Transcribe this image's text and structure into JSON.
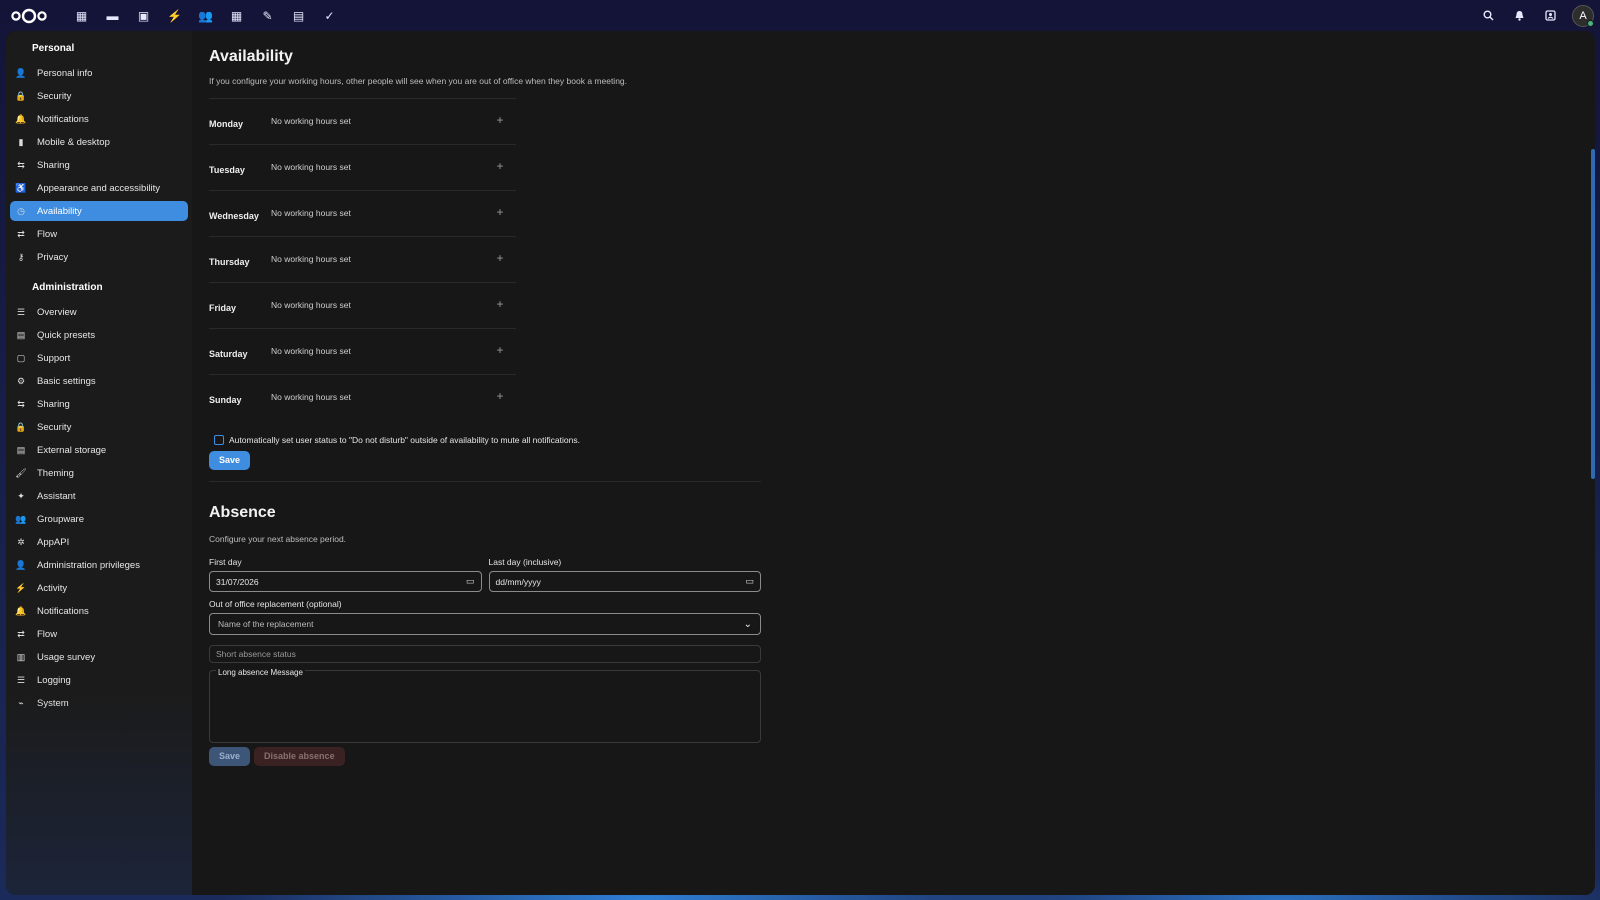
{
  "header": {
    "apps": [
      {
        "icon": "dashboard-icon",
        "glyph": "▦"
      },
      {
        "icon": "files-icon",
        "glyph": "▬"
      },
      {
        "icon": "photos-icon",
        "glyph": "▣"
      },
      {
        "icon": "activity-icon",
        "glyph": "⚡"
      },
      {
        "icon": "contacts-icon",
        "glyph": "👥"
      },
      {
        "icon": "calendar-icon",
        "glyph": "▦"
      },
      {
        "icon": "notes-icon",
        "glyph": "✎"
      },
      {
        "icon": "deck-icon",
        "glyph": "▤"
      },
      {
        "icon": "tasks-icon",
        "glyph": "✓"
      }
    ],
    "avatar_letter": "A"
  },
  "sidebar": {
    "personal_caption": "Personal",
    "personal_items": [
      {
        "label": "Personal info",
        "icon": "person-icon",
        "glyph": "👤"
      },
      {
        "label": "Security",
        "icon": "lock-icon",
        "glyph": "🔒"
      },
      {
        "label": "Notifications",
        "icon": "bell-icon",
        "glyph": "🔔"
      },
      {
        "label": "Mobile & desktop",
        "icon": "phone-icon",
        "glyph": "▮"
      },
      {
        "label": "Sharing",
        "icon": "share-icon",
        "glyph": "⇆"
      },
      {
        "label": "Appearance and accessibility",
        "icon": "accessibility-icon",
        "glyph": "♿"
      },
      {
        "label": "Availability",
        "icon": "clock-icon",
        "glyph": "◷"
      },
      {
        "label": "Flow",
        "icon": "flow-icon",
        "glyph": "⇄"
      },
      {
        "label": "Privacy",
        "icon": "key-icon",
        "glyph": "⚷"
      }
    ],
    "admin_caption": "Administration",
    "admin_items": [
      {
        "label": "Overview",
        "icon": "overview-icon",
        "glyph": "☰"
      },
      {
        "label": "Quick presets",
        "icon": "presets-icon",
        "glyph": "▤"
      },
      {
        "label": "Support",
        "icon": "support-icon",
        "glyph": "▢"
      },
      {
        "label": "Basic settings",
        "icon": "settings-icon",
        "glyph": "⚙"
      },
      {
        "label": "Sharing",
        "icon": "share-icon",
        "glyph": "⇆"
      },
      {
        "label": "Security",
        "icon": "lock-icon",
        "glyph": "🔒"
      },
      {
        "label": "External storage",
        "icon": "storage-icon",
        "glyph": "▤"
      },
      {
        "label": "Theming",
        "icon": "theming-icon",
        "glyph": "🖌"
      },
      {
        "label": "Assistant",
        "icon": "assistant-icon",
        "glyph": "✦"
      },
      {
        "label": "Groupware",
        "icon": "groupware-icon",
        "glyph": "👥"
      },
      {
        "label": "AppAPI",
        "icon": "appapi-icon",
        "glyph": "✲"
      },
      {
        "label": "Administration privileges",
        "icon": "privileges-icon",
        "glyph": "👤"
      },
      {
        "label": "Activity",
        "icon": "activity-icon",
        "glyph": "⚡"
      },
      {
        "label": "Notifications",
        "icon": "bell-icon",
        "glyph": "🔔"
      },
      {
        "label": "Flow",
        "icon": "flow-icon",
        "glyph": "⇄"
      },
      {
        "label": "Usage survey",
        "icon": "survey-icon",
        "glyph": "▥"
      },
      {
        "label": "Logging",
        "icon": "logging-icon",
        "glyph": "☰"
      },
      {
        "label": "System",
        "icon": "system-icon",
        "glyph": "⌁"
      }
    ]
  },
  "availability": {
    "title": "Availability",
    "hint": "If you configure your working hours, other people will see when you are out of office when they book a meeting.",
    "days": [
      {
        "day": "Monday",
        "status": "No working hours set"
      },
      {
        "day": "Tuesday",
        "status": "No working hours set"
      },
      {
        "day": "Wednesday",
        "status": "No working hours set"
      },
      {
        "day": "Thursday",
        "status": "No working hours set"
      },
      {
        "day": "Friday",
        "status": "No working hours set"
      },
      {
        "day": "Saturday",
        "status": "No working hours set"
      },
      {
        "day": "Sunday",
        "status": "No working hours set"
      }
    ],
    "dnd_label": "Automatically set user status to \"Do not disturb\" outside of availability to mute all notifications.",
    "save_label": "Save"
  },
  "absence": {
    "title": "Absence",
    "hint": "Configure your next absence period.",
    "first_day_label": "First day",
    "first_day_value": "31/07/2026",
    "last_day_label": "Last day (inclusive)",
    "last_day_value": "dd/mm/yyyy",
    "replacement_label": "Out of office replacement (optional)",
    "replacement_placeholder": "Name of the replacement",
    "short_status_placeholder": "Short absence status",
    "long_message_label": "Long absence Message",
    "save_label": "Save",
    "disable_label": "Disable absence"
  },
  "colors": {
    "accent": "#3f8de0",
    "background": "#171717"
  }
}
